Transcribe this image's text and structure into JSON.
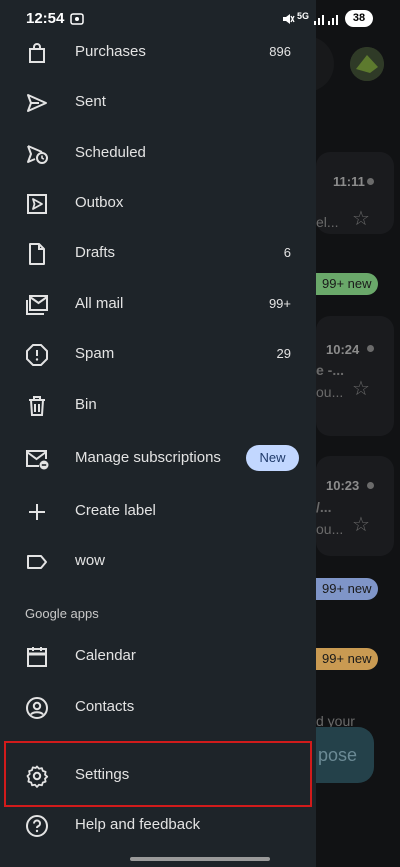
{
  "status_bar": {
    "time": "12:54",
    "battery": "38"
  },
  "drawer": {
    "items": [
      {
        "label": "Purchases",
        "count": "896"
      },
      {
        "label": "Sent",
        "count": ""
      },
      {
        "label": "Scheduled",
        "count": ""
      },
      {
        "label": "Outbox",
        "count": ""
      },
      {
        "label": "Drafts",
        "count": "6"
      },
      {
        "label": "All mail",
        "count": "99+"
      },
      {
        "label": "Spam",
        "count": "29"
      },
      {
        "label": "Bin",
        "count": ""
      },
      {
        "label": "Manage subscriptions",
        "badge": "New"
      },
      {
        "label": "Create label"
      },
      {
        "label": "wow"
      }
    ],
    "section_title": "Google apps",
    "apps": [
      {
        "label": "Calendar"
      },
      {
        "label": "Contacts"
      },
      {
        "label": "Settings"
      },
      {
        "label": "Help and feedback"
      }
    ]
  },
  "background": {
    "times": [
      "11:11",
      "10:24",
      "10:23"
    ],
    "fragments": [
      "el...",
      "e -...",
      "ou...",
      "/...",
      "ou...",
      "d your"
    ],
    "pills": [
      {
        "label": "99+ new",
        "color": "#6aa86a"
      },
      {
        "label": "99+ new",
        "color": "#7f95c8"
      },
      {
        "label": "99+ new",
        "color": "#c99a52"
      }
    ],
    "compose_label": "pose"
  },
  "colors": {
    "drawer_bg": "#1e2429",
    "highlight": "#d21b1b",
    "badge_bg": "#c2d7ff"
  }
}
